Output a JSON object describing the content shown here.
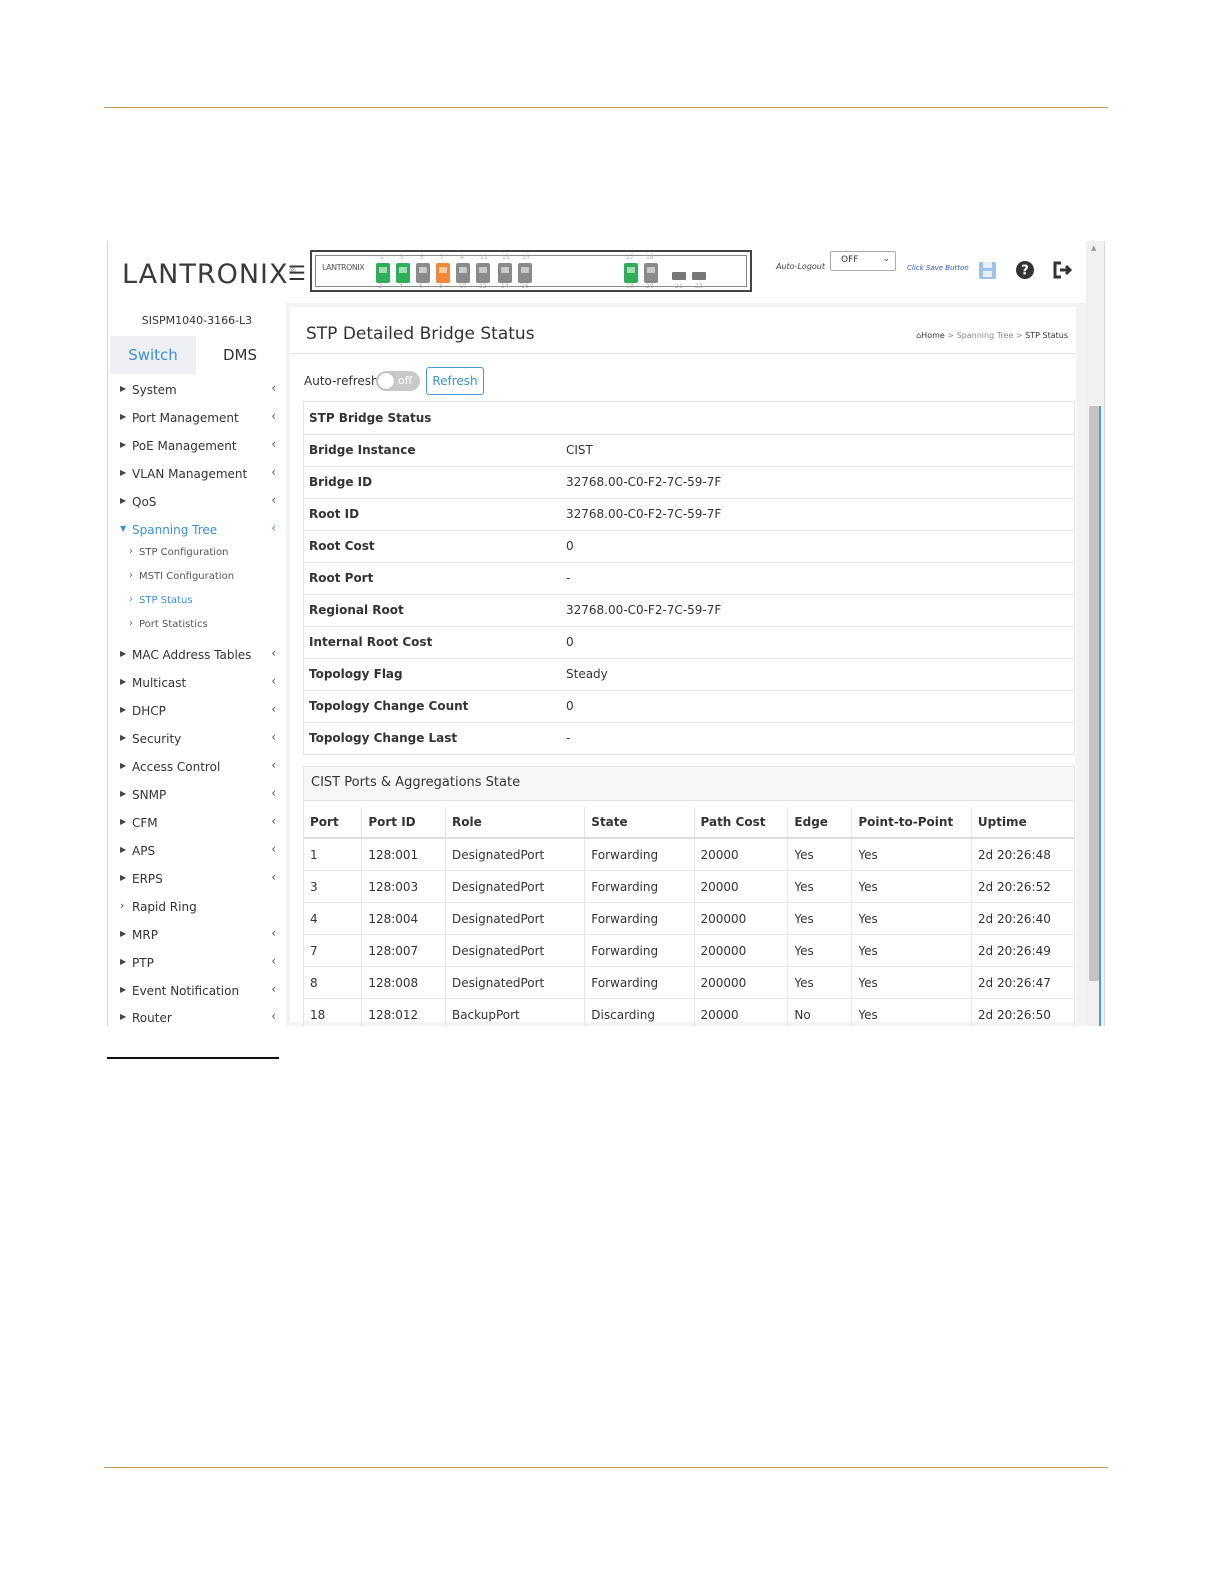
{
  "header": {
    "logo_text": "LANTRONIX",
    "panel_logo": "LANTRONIX",
    "port_numbers_top": [
      "1",
      "3",
      "5",
      "7",
      "9",
      "11",
      "13",
      "15",
      "17",
      "19"
    ],
    "port_numbers_bottom": [
      "2",
      "4",
      "6",
      "8",
      "10",
      "12",
      "14",
      "16",
      "18",
      "20",
      "21",
      "22"
    ],
    "auto_logout_label": "Auto-Logout",
    "auto_logout_value": "OFF",
    "save_hint": "Click Save Button",
    "icons": [
      "save-icon",
      "help-icon",
      "logout-icon"
    ]
  },
  "sidebar": {
    "model": "SISPM1040-3166-L3",
    "tabs": [
      "Switch",
      "DMS"
    ],
    "items": [
      {
        "label": "System"
      },
      {
        "label": "Port Management"
      },
      {
        "label": "PoE Management"
      },
      {
        "label": "VLAN Management"
      },
      {
        "label": "QoS"
      },
      {
        "label": "Spanning Tree"
      },
      {
        "label": "MAC Address Tables"
      },
      {
        "label": "Multicast"
      },
      {
        "label": "DHCP"
      },
      {
        "label": "Security"
      },
      {
        "label": "Access Control"
      },
      {
        "label": "SNMP"
      },
      {
        "label": "CFM"
      },
      {
        "label": "APS"
      },
      {
        "label": "ERPS"
      },
      {
        "label": "Rapid Ring"
      },
      {
        "label": "MRP"
      },
      {
        "label": "PTP"
      },
      {
        "label": "Event Notification"
      },
      {
        "label": "Router"
      }
    ],
    "spanning_tree_sub": [
      "STP Configuration",
      "MSTI Configuration",
      "STP Status",
      "Port Statistics"
    ]
  },
  "page": {
    "title": "STP Detailed Bridge Status",
    "breadcrumb": {
      "home": "Home",
      "section": "Spanning Tree",
      "current": "STP Status"
    },
    "auto_refresh_label": "Auto-refresh",
    "toggle_text": "off",
    "refresh_label": "Refresh"
  },
  "bridge_status": {
    "heading": "STP Bridge Status",
    "rows": [
      {
        "key": "Bridge Instance",
        "value": "CIST"
      },
      {
        "key": "Bridge ID",
        "value": "32768.00-C0-F2-7C-59-7F"
      },
      {
        "key": "Root ID",
        "value": "32768.00-C0-F2-7C-59-7F"
      },
      {
        "key": "Root Cost",
        "value": "0"
      },
      {
        "key": "Root Port",
        "value": "-"
      },
      {
        "key": "Regional Root",
        "value": "32768.00-C0-F2-7C-59-7F"
      },
      {
        "key": "Internal Root Cost",
        "value": "0"
      },
      {
        "key": "Topology Flag",
        "value": "Steady"
      },
      {
        "key": "Topology Change Count",
        "value": "0"
      },
      {
        "key": "Topology Change Last",
        "value": "-"
      }
    ]
  },
  "ports_state": {
    "heading": "CIST Ports & Aggregations State",
    "columns": [
      "Port",
      "Port ID",
      "Role",
      "State",
      "Path Cost",
      "Edge",
      "Point-to-Point",
      "Uptime"
    ],
    "rows": [
      [
        "1",
        "128:001",
        "DesignatedPort",
        "Forwarding",
        "20000",
        "Yes",
        "Yes",
        "2d 20:26:48"
      ],
      [
        "3",
        "128:003",
        "DesignatedPort",
        "Forwarding",
        "20000",
        "Yes",
        "Yes",
        "2d 20:26:52"
      ],
      [
        "4",
        "128:004",
        "DesignatedPort",
        "Forwarding",
        "200000",
        "Yes",
        "Yes",
        "2d 20:26:40"
      ],
      [
        "7",
        "128:007",
        "DesignatedPort",
        "Forwarding",
        "200000",
        "Yes",
        "Yes",
        "2d 20:26:49"
      ],
      [
        "8",
        "128:008",
        "DesignatedPort",
        "Forwarding",
        "200000",
        "Yes",
        "Yes",
        "2d 20:26:47"
      ],
      [
        "18",
        "128:012",
        "BackupPort",
        "Discarding",
        "20000",
        "No",
        "Yes",
        "2d 20:26:50"
      ]
    ]
  },
  "colors": {
    "accent": "#3a8fd6",
    "rule": "#c8955a",
    "port_up": "#2fae5a",
    "port_poe": "#f0883a"
  }
}
